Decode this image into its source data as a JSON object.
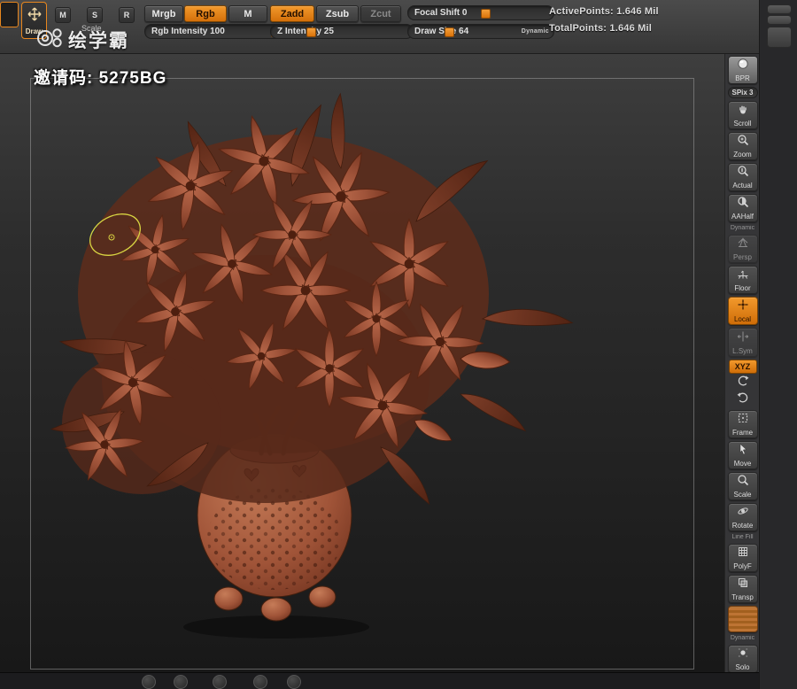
{
  "accent_color": "#e8871e",
  "toolbar": {
    "brush_button": {
      "label": "Draw",
      "icon": "move-cross-icon"
    },
    "gizmo": {
      "m": "M",
      "s": "S",
      "r": "R",
      "caption": "Scale"
    },
    "mode_buttons": [
      {
        "label": "Mrgb",
        "active": false
      },
      {
        "label": "Rgb",
        "active": true
      },
      {
        "label": "M",
        "active": false
      }
    ],
    "sculpt_buttons": [
      {
        "label": "Zadd",
        "active": true
      },
      {
        "label": "Zsub",
        "active": false
      },
      {
        "label": "Zcut",
        "active": false,
        "disabled": true
      }
    ],
    "sliders": {
      "rgb_intensity": {
        "label": "Rgb Intensity 100",
        "value": 100
      },
      "z_intensity": {
        "label": "Z Intensity 25",
        "value": 25
      },
      "focal_shift": {
        "label": "Focal Shift 0",
        "value": 0
      },
      "draw_size": {
        "label": "Draw Size 64",
        "value": 64,
        "tag": "Dynamic"
      }
    },
    "stats": {
      "active_points": "ActivePoints: 1.646 Mil",
      "total_points": "TotalPoints: 1.646 Mil"
    }
  },
  "brand": {
    "logo_text": "绘学霸",
    "invite_code": "邀请码: 5275BG"
  },
  "right_toolbar": {
    "items": [
      {
        "label": "BPR",
        "icon": "render-sphere-icon"
      },
      {
        "label": "SPix 3",
        "icon": "spix-slider"
      },
      {
        "label": "Scroll",
        "icon": "hand-icon"
      },
      {
        "label": "Zoom",
        "icon": "magnifier-plus-icon"
      },
      {
        "label": "Actual",
        "icon": "magnifier-actual-icon"
      },
      {
        "label": "AAHalf",
        "icon": "magnifier-half-icon"
      },
      {
        "label": "Persp",
        "icon": "perspective-icon",
        "disabled": true,
        "overlay": "Dynamic"
      },
      {
        "label": "Floor",
        "icon": "floor-grid-icon"
      },
      {
        "label": "Local",
        "icon": "local-pivot-icon",
        "active": true
      },
      {
        "label": "L.Sym",
        "icon": "symmetry-icon",
        "disabled": true
      },
      {
        "label": "XYZ",
        "icon": "axis-text",
        "accent": true
      },
      {
        "label": "",
        "icon": "rotate-ccw-icon"
      },
      {
        "label": "",
        "icon": "rotate-cw-icon"
      },
      {
        "label": "Frame",
        "icon": "frame-dashed-icon"
      },
      {
        "label": "Move",
        "icon": "cursor-icon"
      },
      {
        "label": "Scale",
        "icon": "magnifier-icon"
      },
      {
        "label": "Rotate",
        "icon": "orbit-icon"
      },
      {
        "label": "PolyF",
        "icon": "polyframe-grid-icon",
        "overlay": "Line Fill"
      },
      {
        "label": "Transp",
        "icon": "transparency-icon"
      },
      {
        "label": "",
        "icon": "ghost-material-icon",
        "ghost": true
      },
      {
        "label": "Solo",
        "icon": "solo-icon",
        "overlay": "Dynamic"
      }
    ]
  },
  "canvas": {
    "cursor_color": "#d8d442",
    "material_base": "#a8583e",
    "material_dark": "#6b2f1e",
    "material_light": "#c9805f",
    "background_top": "#3c3c3c",
    "background_bottom": "#151515"
  },
  "taskbar": {
    "icons": [
      "app-icon-1",
      "app-icon-2",
      "app-icon-3",
      "app-icon-4",
      "app-icon-5"
    ]
  }
}
